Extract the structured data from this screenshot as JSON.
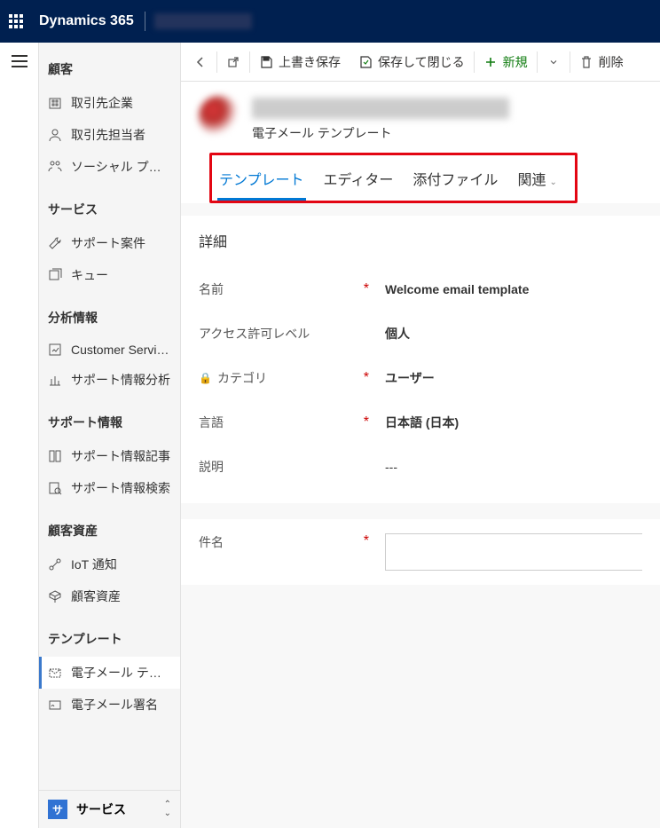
{
  "topbar": {
    "brand": "Dynamics 365"
  },
  "commands": {
    "save": "上書き保存",
    "save_close": "保存して閉じる",
    "new": "新規",
    "delete": "削除"
  },
  "nav": {
    "groups": [
      {
        "title": "顧客",
        "items": [
          {
            "label": "取引先企業",
            "icon": "building"
          },
          {
            "label": "取引先担当者",
            "icon": "person"
          },
          {
            "label": "ソーシャル プロ...",
            "icon": "social"
          }
        ]
      },
      {
        "title": "サービス",
        "items": [
          {
            "label": "サポート案件",
            "icon": "wrench"
          },
          {
            "label": "キュー",
            "icon": "queue"
          }
        ]
      },
      {
        "title": "分析情報",
        "items": [
          {
            "label": "Customer Service ...",
            "icon": "chart"
          },
          {
            "label": "サポート情報分析",
            "icon": "analytics"
          }
        ]
      },
      {
        "title": "サポート情報",
        "items": [
          {
            "label": "サポート情報記事",
            "icon": "article"
          },
          {
            "label": "サポート情報検索",
            "icon": "search-book"
          }
        ]
      },
      {
        "title": "顧客資産",
        "items": [
          {
            "label": "IoT 通知",
            "icon": "iot"
          },
          {
            "label": "顧客資産",
            "icon": "asset"
          }
        ]
      },
      {
        "title": "テンプレート",
        "items": [
          {
            "label": "電子メール テン...",
            "icon": "mail",
            "selected": true
          },
          {
            "label": "電子メール署名",
            "icon": "signature"
          }
        ]
      }
    ],
    "bottom": {
      "badge": "サ",
      "label": "サービス"
    }
  },
  "record": {
    "subtitle": "電子メール テンプレート",
    "tabs": [
      "テンプレート",
      "エディター",
      "添付ファイル",
      "関連"
    ],
    "section_title": "詳細",
    "fields": {
      "name_label": "名前",
      "name_value": "Welcome email template",
      "perm_label": "アクセス許可レベル",
      "perm_value": "個人",
      "cat_label": "カテゴリ",
      "cat_value": "ユーザー",
      "lang_label": "言語",
      "lang_value": "日本語 (日本)",
      "desc_label": "説明",
      "desc_value": "---"
    },
    "subject_label": "件名"
  }
}
